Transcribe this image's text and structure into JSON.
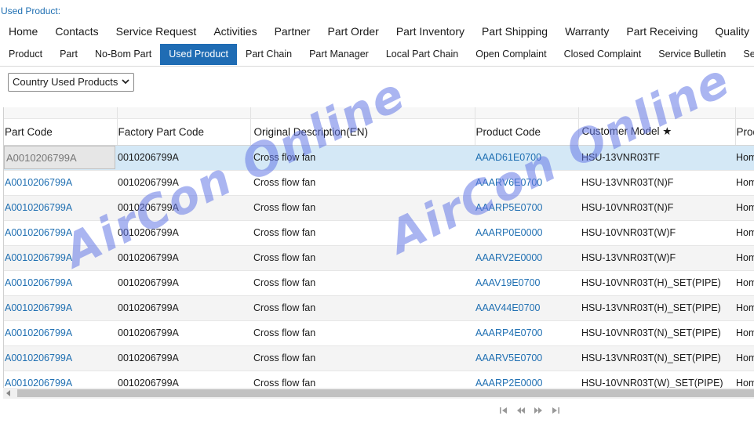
{
  "page": {
    "title": "Used Product:"
  },
  "nav_main": [
    "Home",
    "Contacts",
    "Service Request",
    "Activities",
    "Partner",
    "Part Order",
    "Part Inventory",
    "Part Shipping",
    "Warranty",
    "Part Receiving",
    "Quality",
    "Appl"
  ],
  "nav_sub": [
    "Product",
    "Part",
    "No-Bom Part",
    "Used Product",
    "Part Chain",
    "Part Manager",
    "Local Part Chain",
    "Open Complaint",
    "Closed Complaint",
    "Service Bulletin",
    "Service"
  ],
  "nav_sub_active": "Used Product",
  "filter": {
    "selected": "Country Used Products"
  },
  "table": {
    "columns": [
      "Part Code",
      "Factory Part Code",
      "Original Description(EN)",
      "Product Code",
      "Customer Model ★",
      "Prod"
    ],
    "rows": [
      [
        "A0010206799A",
        "0010206799A",
        "Cross flow fan",
        "AAAD61E0700",
        "HSU-13VNR03TF",
        "Hom"
      ],
      [
        "A0010206799A",
        "0010206799A",
        "Cross flow fan",
        "AAARV6E0700",
        "HSU-13VNR03T(N)F",
        "Hom"
      ],
      [
        "A0010206799A",
        "0010206799A",
        "Cross flow fan",
        "AAARP5E0700",
        "HSU-10VNR03T(N)F",
        "Hom"
      ],
      [
        "A0010206799A",
        "0010206799A",
        "Cross flow fan",
        "AAARP0E0000",
        "HSU-10VNR03T(W)F",
        "Hom"
      ],
      [
        "A0010206799A",
        "0010206799A",
        "Cross flow fan",
        "AAARV2E0000",
        "HSU-13VNR03T(W)F",
        "Hom"
      ],
      [
        "A0010206799A",
        "0010206799A",
        "Cross flow fan",
        "AAAV19E0700",
        "HSU-10VNR03T(H)_SET(PIPE)",
        "Hom"
      ],
      [
        "A0010206799A",
        "0010206799A",
        "Cross flow fan",
        "AAAV44E0700",
        "HSU-13VNR03T(H)_SET(PIPE)",
        "Hom"
      ],
      [
        "A0010206799A",
        "0010206799A",
        "Cross flow fan",
        "AAARP4E0700",
        "HSU-10VNR03T(N)_SET(PIPE)",
        "Hom"
      ],
      [
        "A0010206799A",
        "0010206799A",
        "Cross flow fan",
        "AAARV5E0700",
        "HSU-13VNR03T(N)_SET(PIPE)",
        "Hom"
      ],
      [
        "A0010206799A",
        "0010206799A",
        "Cross flow fan",
        "AAARP2E0000",
        "HSU-10VNR03T(W)_SET(PIPE)",
        "Hom"
      ]
    ]
  },
  "watermark": {
    "text": "AirCon Online"
  },
  "colors": {
    "link": "#1f6fb2",
    "active_tab": "#1f6cb4",
    "selected_row": "#d4e8f6"
  },
  "icons": {
    "filter": "chevron-down-icon",
    "pager": [
      "first-page-icon",
      "prev-page-icon",
      "next-page-icon",
      "last-page-icon"
    ]
  }
}
